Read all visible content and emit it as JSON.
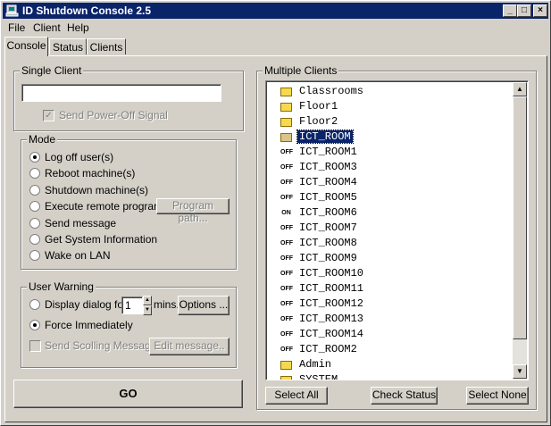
{
  "window": {
    "title": "ID Shutdown Console 2.5"
  },
  "menu": [
    "File",
    "Client",
    "Help"
  ],
  "tabs": [
    "Console",
    "Status",
    "Clients"
  ],
  "single_client": {
    "label": "Single Client",
    "input_value": "",
    "send_poweroff": "Send Power-Off Signal"
  },
  "mode": {
    "label": "Mode",
    "options": [
      "Log off user(s)",
      "Reboot machine(s)",
      "Shutdown machine(s)",
      "Execute remote program",
      "Send message",
      "Get System Information",
      "Wake on LAN"
    ],
    "selected": "Log off user(s)",
    "program_path_btn": "Program path..."
  },
  "user_warning": {
    "label": "User Warning",
    "display_dialog": "Display dialog for",
    "minutes": "1",
    "mins_label": "mins.",
    "options_btn": "Options ...",
    "force_immediately": "Force Immediately",
    "scrolling_message": "Send Scolling Message",
    "edit_message_btn": "Edit message.."
  },
  "go_button": "GO",
  "multiple_clients": {
    "label": "Multiple Clients",
    "items": [
      {
        "icon": "folder-icon",
        "badge": "",
        "name": "Classrooms"
      },
      {
        "icon": "folder-icon",
        "badge": "",
        "name": "Floor1"
      },
      {
        "icon": "folder-icon",
        "badge": "",
        "name": "Floor2"
      },
      {
        "icon": "open-folder-icon",
        "badge": "",
        "name": "ICT_ROOM",
        "selected": true
      },
      {
        "icon": "off-icon",
        "badge": "OFF",
        "name": "ICT_ROOM1"
      },
      {
        "icon": "off-icon",
        "badge": "OFF",
        "name": "ICT_ROOM3"
      },
      {
        "icon": "off-icon",
        "badge": "OFF",
        "name": "ICT_ROOM4"
      },
      {
        "icon": "off-icon",
        "badge": "OFF",
        "name": "ICT_ROOM5"
      },
      {
        "icon": "on-icon",
        "badge": "ON",
        "name": "ICT_ROOM6"
      },
      {
        "icon": "off-icon",
        "badge": "OFF",
        "name": "ICT_ROOM7"
      },
      {
        "icon": "off-icon",
        "badge": "OFF",
        "name": "ICT_ROOM8"
      },
      {
        "icon": "off-icon",
        "badge": "OFF",
        "name": "ICT_ROOM9"
      },
      {
        "icon": "off-icon",
        "badge": "OFF",
        "name": "ICT_ROOM10"
      },
      {
        "icon": "off-icon",
        "badge": "OFF",
        "name": "ICT_ROOM11"
      },
      {
        "icon": "off-icon",
        "badge": "OFF",
        "name": "ICT_ROOM12"
      },
      {
        "icon": "off-icon",
        "badge": "OFF",
        "name": "ICT_ROOM13"
      },
      {
        "icon": "off-icon",
        "badge": "OFF",
        "name": "ICT_ROOM14"
      },
      {
        "icon": "off-icon",
        "badge": "OFF",
        "name": "ICT_ROOM2"
      },
      {
        "icon": "folder-icon",
        "badge": "",
        "name": "Admin"
      },
      {
        "icon": "folder-icon",
        "badge": "",
        "name": "SYSTEM"
      }
    ],
    "select_all": "Select All",
    "check_status": "Check Status",
    "select_none": "Select None"
  },
  "colors": {
    "title_bar": "#0a246a",
    "face": "#d4d0c8",
    "selection": "#0a246a"
  }
}
